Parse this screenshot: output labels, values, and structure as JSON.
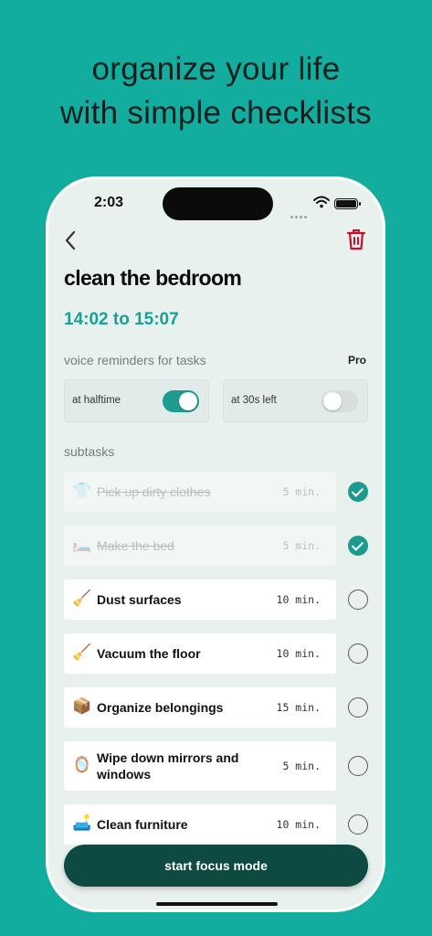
{
  "headline": {
    "line1": "organize your life",
    "line2": "with simple checklists"
  },
  "status_bar": {
    "time": "2:03",
    "wifi_icon": "wifi-icon",
    "battery_icon": "battery-icon"
  },
  "nav": {
    "back_icon": "chevron-left-icon",
    "delete_icon": "trash-icon"
  },
  "checklist": {
    "title": "clean the bedroom",
    "time_range": "14:02 to 15:07"
  },
  "voice_reminders": {
    "label": "voice reminders for tasks",
    "badge": "Pro",
    "options": [
      {
        "label": "at halftime",
        "enabled": true
      },
      {
        "label": "at 30s left",
        "enabled": false
      }
    ]
  },
  "subtasks": {
    "label": "subtasks",
    "items": [
      {
        "emoji": "👕",
        "name": "Pick up dirty clothes",
        "duration": "5 min.",
        "done": true
      },
      {
        "emoji": "🛏️",
        "name": "Make the bed",
        "duration": "5 min.",
        "done": true
      },
      {
        "emoji": "🧹",
        "name": "Dust surfaces",
        "duration": "10 min.",
        "done": false
      },
      {
        "emoji": "🧹",
        "name": "Vacuum the floor",
        "duration": "10 min.",
        "done": false
      },
      {
        "emoji": "📦",
        "name": "Organize belongings",
        "duration": "15 min.",
        "done": false
      },
      {
        "emoji": "🪞",
        "name": "Wipe down mirrors and windows",
        "duration": "5 min.",
        "done": false
      },
      {
        "emoji": "🛋️",
        "name": "Clean furniture",
        "duration": "10 min.",
        "done": false
      }
    ]
  },
  "cta": {
    "label": "start focus mode"
  },
  "colors": {
    "background": "#12ad9f",
    "accent": "#1a9b8e",
    "cta": "#0f4a42",
    "delete": "#c8102e"
  }
}
